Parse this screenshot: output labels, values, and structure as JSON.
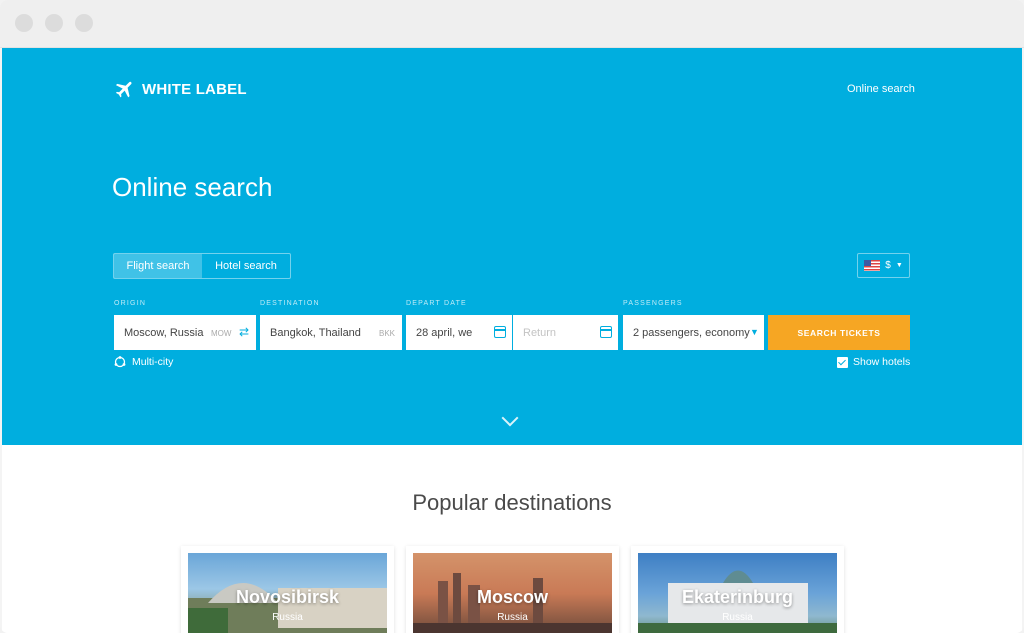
{
  "brand": {
    "name": "WHITE LABEL"
  },
  "header": {
    "link": "Online search"
  },
  "hero": {
    "title": "Online search"
  },
  "tabs": [
    {
      "label": "Flight search",
      "active": true
    },
    {
      "label": "Hotel search",
      "active": false
    }
  ],
  "currency": {
    "symbol": "$"
  },
  "form": {
    "origin": {
      "label": "ORIGIN",
      "value": "Moscow, Russia",
      "code": "MOW"
    },
    "destination": {
      "label": "DESTINATION",
      "value": "Bangkok, Thailand",
      "code": "BKK"
    },
    "depart": {
      "label": "DEPART DATE",
      "value": "28 april, we",
      "return_placeholder": "Return"
    },
    "passengers": {
      "label": "PASSENGERS",
      "value": "2 passengers, economy"
    },
    "search_button": "SEARCH TICKETS",
    "multi_city": "Multi-city",
    "show_hotels": "Show hotels"
  },
  "popular": {
    "title": "Popular destinations",
    "items": [
      {
        "city": "Novosibirsk",
        "country": "Russia"
      },
      {
        "city": "Moscow",
        "country": "Russia"
      },
      {
        "city": "Ekaterinburg",
        "country": "Russia"
      }
    ]
  },
  "colors": {
    "primary": "#00aedf",
    "accent": "#f6a623"
  },
  "icons": [
    "airplane-icon",
    "swap-icon",
    "calendar-icon",
    "chevron-down-icon",
    "multi-city-icon",
    "checkbox-icon",
    "flag-us-icon"
  ]
}
